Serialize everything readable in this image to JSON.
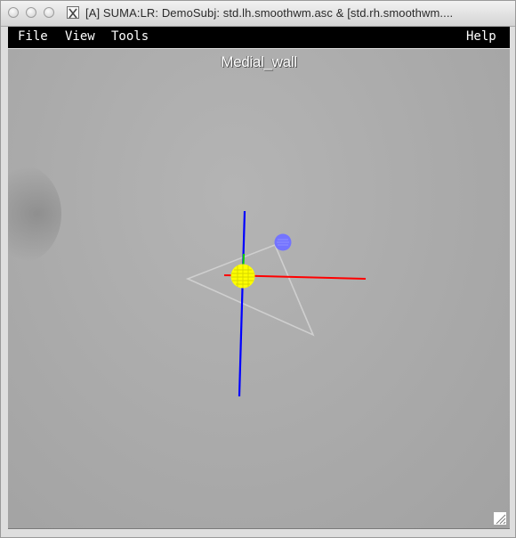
{
  "window": {
    "title": "[A] SUMA:LR: DemoSubj: std.lh.smoothwm.asc &  [std.rh.smoothwm...."
  },
  "menubar": {
    "file": "File",
    "view": "View",
    "tools": "Tools",
    "help": "Help"
  },
  "viewport": {
    "label": "Medial_wall",
    "background_color": "#aaaaaa"
  },
  "scene": {
    "axis_colors": {
      "x": "#ff0000",
      "y": "#00cc00",
      "z": "#0000ff"
    },
    "crosshair_node_color": "#ffff00",
    "selected_node_color": "#7070ff",
    "triangle_outline_color": "#cfcfcf"
  }
}
